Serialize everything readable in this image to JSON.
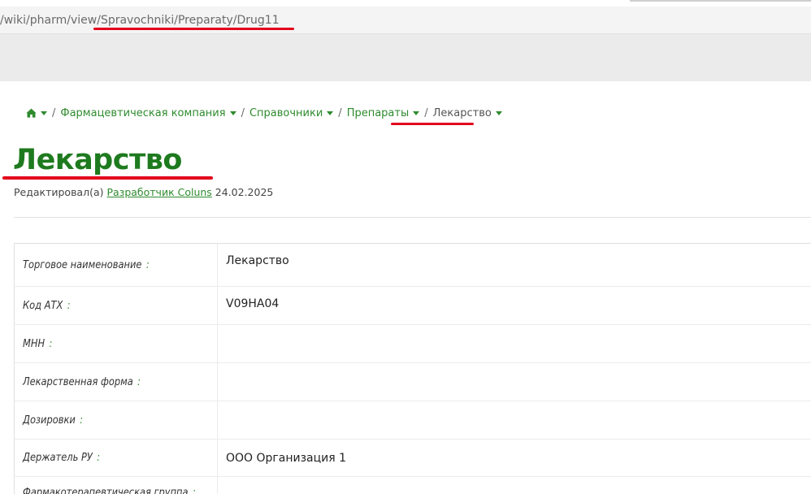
{
  "browser": {
    "url_prefix": "/wiki/pharm/view/",
    "url_path": "Spravochniki/Preparaty/Drug11"
  },
  "breadcrumb": {
    "home_icon": "home-icon",
    "items": [
      {
        "label": "Фармацевтическая компания"
      },
      {
        "label": "Справочники"
      },
      {
        "label": "Препараты"
      },
      {
        "label": "Лекарство"
      }
    ],
    "separator": "/"
  },
  "page": {
    "title": "Лекарство",
    "edited_prefix": "Редактировал(а)",
    "edited_author": "Разработчик Coluns",
    "edited_date": "24.02.2025"
  },
  "properties": [
    {
      "label": "Торговое наименование",
      "value": "Лекарство"
    },
    {
      "label": "Код АТХ",
      "value": "V09HA04"
    },
    {
      "label": "МНН",
      "value": ""
    },
    {
      "label": "Лекарственная форма",
      "value": ""
    },
    {
      "label": "Дозировки",
      "value": ""
    },
    {
      "label": "Держатель РУ",
      "value": "ООО Организация 1"
    },
    {
      "label": "Фармакотерапевтическая группа",
      "value": ""
    }
  ],
  "colors": {
    "accent_green": "#2e8b2e",
    "title_green": "#1e7a1e",
    "annotation_red": "#e3001b"
  }
}
